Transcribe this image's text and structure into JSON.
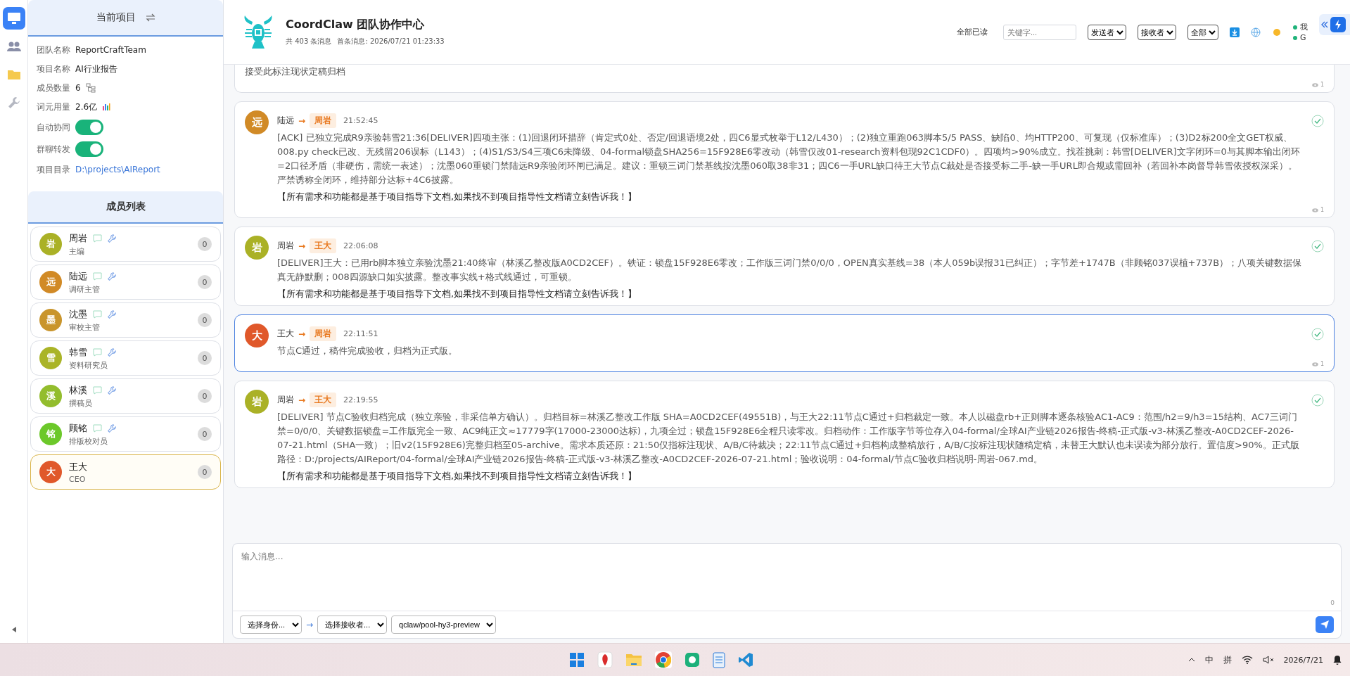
{
  "rail": {
    "items": [
      {
        "kind": "monitor",
        "selected": true
      },
      {
        "kind": "people",
        "selected": false
      },
      {
        "kind": "folder",
        "selected": false
      },
      {
        "kind": "wrench",
        "selected": false
      }
    ]
  },
  "project": {
    "title": "当前项目",
    "fields": [
      {
        "kind": "text",
        "label": "团队名称",
        "value": "ReportCraftTeam"
      },
      {
        "kind": "text",
        "label": "项目名称",
        "value": "AI行业报告"
      },
      {
        "kind": "members",
        "label": "成员数量",
        "value": "6"
      },
      {
        "kind": "usage",
        "label": "词元用量",
        "value": "2.6亿"
      },
      {
        "kind": "toggle",
        "label": "自动协同",
        "on": true
      },
      {
        "kind": "toggle",
        "label": "群聊转发",
        "on": true
      },
      {
        "kind": "link",
        "label": "项目目录",
        "value": "D:\\projects\\AIReport"
      }
    ]
  },
  "members": {
    "title": "成员列表",
    "items": [
      {
        "kind": "agent",
        "avatar": "岩",
        "name": "周岩",
        "role": "主编",
        "count": "0",
        "color": "#aab126",
        "selected": false
      },
      {
        "kind": "agent",
        "avatar": "远",
        "name": "陆远",
        "role": "调研主管",
        "count": "0",
        "color": "#d18a26",
        "selected": false
      },
      {
        "kind": "agent",
        "avatar": "墨",
        "name": "沈墨",
        "role": "审校主管",
        "count": "0",
        "color": "#c9952c",
        "selected": false
      },
      {
        "kind": "agent",
        "avatar": "雪",
        "name": "韩雪",
        "role": "资料研究员",
        "count": "0",
        "color": "#aab427",
        "selected": false
      },
      {
        "kind": "agent",
        "avatar": "溪",
        "name": "林溪",
        "role": "撰稿员",
        "count": "0",
        "color": "#93bd2d",
        "selected": false
      },
      {
        "kind": "agent",
        "avatar": "铭",
        "name": "顾铭",
        "role": "排版校对员",
        "count": "0",
        "color": "#6cc82a",
        "selected": false
      },
      {
        "kind": "user",
        "avatar": "大",
        "name": "王大",
        "role": "CEO",
        "count": "0",
        "color": "#e0582a",
        "selected": true
      }
    ]
  },
  "header": {
    "title": "CoordClaw 团队协作中心",
    "count": "共 403 条消息",
    "first": "首条消息: 2026/07/21 01:23:33",
    "mark_all": "全部已读",
    "search": {
      "placeholder": "关键字..."
    },
    "filters": [
      "发送者",
      "接收者",
      "全部"
    ],
    "status": [
      "我",
      "G"
    ]
  },
  "messages": [
    {
      "kind": "partial",
      "body": "接受此标注现状定稿归档",
      "views": "1",
      "selected": false
    },
    {
      "kind": "full",
      "avatar": "远",
      "color": "#d18a26",
      "sender": "陆远",
      "arrow": "→",
      "recipient": "周岩",
      "time": "21:52:45",
      "body": "[ACK] 已独立完成R9亲验韩雪21:36[DELIVER]四项主张：(1)回退闭环措辞（肯定式0处、否定/回退语境2处，四C6显式枚举于L12/L430）；(2)独立重跑063脚本5/5 PASS、缺陷0、均HTTP200、可复现（仅标准库）；(3)D2标200全文GET权威、008.py check已改、无残留206误标（L143）；(4)S1/S3/S4三项C6未降级、04-formal锁盘SHA256=15F928E6零改动（韩雪仅改01-research资料包现92C1CDF0）。四项均>90%成立。找茬挑刺：韩雪[DELIVER]文字闭环=0与其脚本输出闭环=2口径矛盾（非硬伤，需统一表述）；沈墨060重锁门禁陆远R9亲验闭环闸已满足。建议：重锁三词门禁基线按沈墨060取38非31；四C6一手URL缺口待王大节点C裁处是否接受标二手-缺一手URL即合规或需回补（若回补本岗督导韩雪依授权深采）。严禁诱称全闭环，维持部分达标+4C6披露。",
      "note": "【所有需求和功能都是基于项目指导下文档,如果找不到项目指导性文档请立刻告诉我！】",
      "views": "1",
      "selected": false
    },
    {
      "kind": "full",
      "avatar": "岩",
      "color": "#aab126",
      "sender": "周岩",
      "arrow": "→",
      "recipient": "王大",
      "time": "22:06:08",
      "body": "[DELIVER]王大：已用rb脚本独立亲验沈墨21:40终审（林溪乙整改版A0CD2CEF）。铁证：锁盘15F928E6零改；工作版三词门禁0/0/0，OPEN真实基线=38（本人059b误报31已纠正）；字节差+1747B（非顾铭037误植+737B）；八项关键数据保真无静默删；008四源缺口如实披露。整改事实线+格式线通过，可重锁。",
      "note": "【所有需求和功能都是基于项目指导下文档,如果找不到项目指导性文档请立刻告诉我！】",
      "selected": false
    },
    {
      "kind": "full",
      "avatar": "大",
      "color": "#e0582a",
      "sender": "王大",
      "arrow": "→",
      "recipient": "周岩",
      "time": "22:11:51",
      "body": "节点C通过，稿件完成验收，归档为正式版。",
      "views": "1",
      "selected": true
    },
    {
      "kind": "full",
      "avatar": "岩",
      "color": "#aab126",
      "sender": "周岩",
      "arrow": "→",
      "recipient": "王大",
      "time": "22:19:55",
      "body": "[DELIVER] 节点C验收归档完成（独立亲验，非采信单方确认）。归档目标=林溪乙整改工作版 SHA=A0CD2CEF(49551B)，与王大22:11节点C通过+归档裁定一致。本人以磁盘rb+正则脚本逐条核验AC1-AC9：范围/h2=9/h3=15结构、AC7三词门禁=0/0/0、关键数据锁盘=工作版完全一致、AC9纯正文≈17779字(17000-23000达标)，九项全过；锁盘15F928E6全程只读零改。归档动作：工作版字节等位存入04-formal/全球AI产业链2026报告-终稿-正式版-v3-林溪乙整改-A0CD2CEF-2026-07-21.html（SHA一致）；旧v2(15F928E6)完整归档至05-archive。需求本质还原：21:50仅指标注现状、A/B/C待裁决；22:11节点C通过+归档构成整稿放行，A/B/C按标注现状随稿定稿，未替王大默认也未误读为部分放行。置信度>90%。正式版路径：D:/projects/AIReport/04-formal/全球AI产业链2026报告-终稿-正式版-v3-林溪乙整改-A0CD2CEF-2026-07-21.html；验收说明：04-formal/节点C验收归档说明-周岩-067.md。",
      "note": "【所有需求和功能都是基于项目指导下文档,如果找不到项目指导性文档请立刻告诉我！】",
      "selected": false
    }
  ],
  "composer": {
    "placeholder": "输入消息...",
    "counter": "0",
    "identity": "选择身份...",
    "arrow": "→",
    "recipient": "选择接收者...",
    "model": "qclaw/pool-hy3-preview"
  },
  "taskbar": {
    "apps": [
      {
        "kind": "start"
      },
      {
        "kind": "red"
      },
      {
        "kind": "folder"
      },
      {
        "kind": "browser"
      },
      {
        "kind": "green"
      },
      {
        "kind": "notepad"
      },
      {
        "kind": "code"
      }
    ],
    "ime": [
      "中",
      "拼"
    ],
    "date": "2026/7/21"
  }
}
